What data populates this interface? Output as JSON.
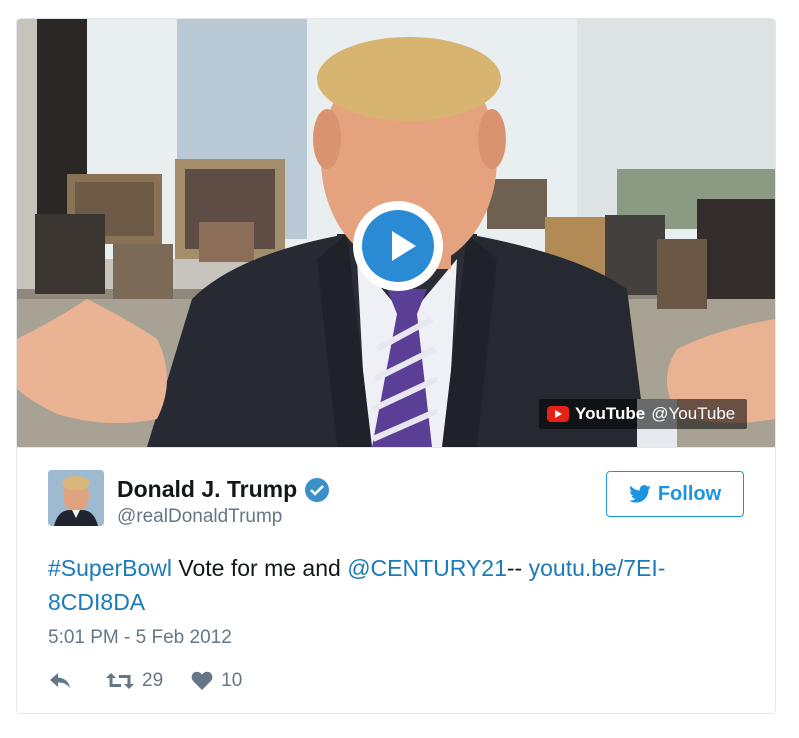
{
  "video": {
    "provider_name": "YouTube",
    "provider_handle": "@YouTube",
    "play_icon": "play-circle-icon",
    "provider_icon": "youtube-logo-icon"
  },
  "author": {
    "name": "Donald J. Trump",
    "handle": "@realDonaldTrump",
    "verified_icon": "verified-badge-icon"
  },
  "follow_button": {
    "label": "Follow",
    "icon": "twitter-bird-icon"
  },
  "tweet": {
    "hashtag": "#SuperBowl",
    "text_middle": " Vote for me and ",
    "mention": "@CENTURY21",
    "text_separator": "-- ",
    "link": "youtu.be/7EI-8CDI8DA",
    "timestamp": "5:01 PM - 5 Feb 2012"
  },
  "actions": {
    "reply_icon": "reply-icon",
    "retweet_icon": "retweet-icon",
    "retweet_count": "29",
    "like_icon": "heart-icon",
    "like_count": "10"
  },
  "colors": {
    "link": "#1b7ab8",
    "follow": "#1b95e0",
    "play": "#2b8ad4",
    "youtube_red": "#e62117",
    "muted": "#657786"
  }
}
